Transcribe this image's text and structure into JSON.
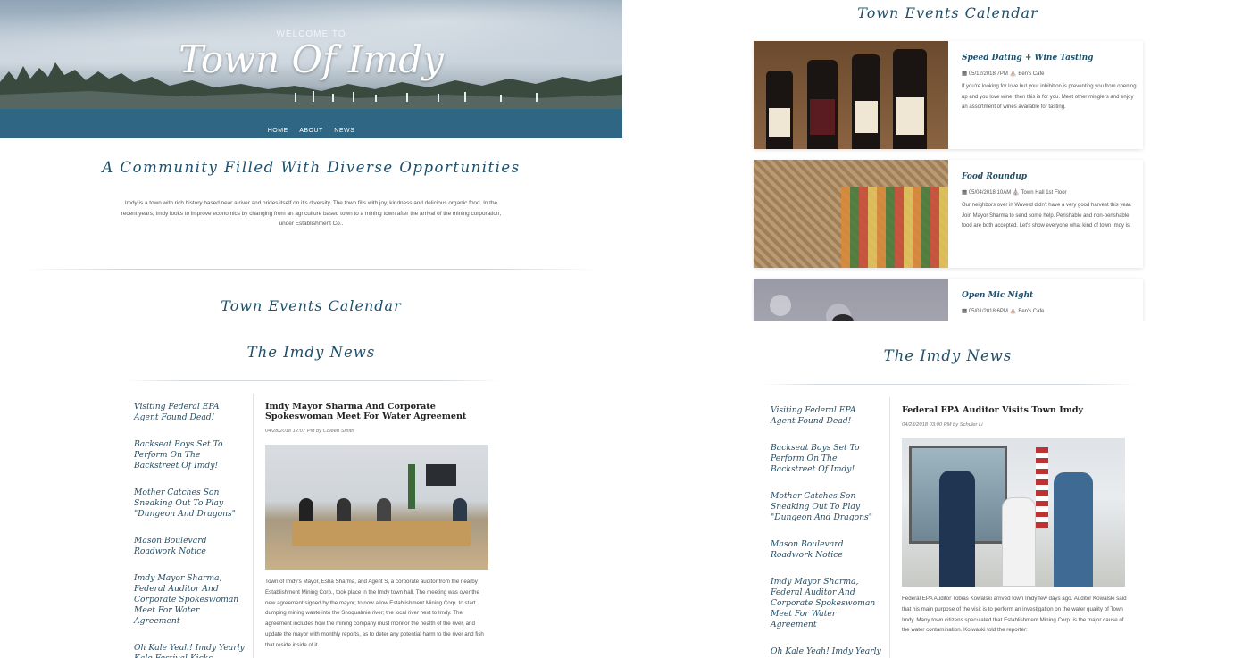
{
  "hero": {
    "welcome": "WELCOME TO",
    "title": "Town Of Imdy",
    "nav": [
      "HOME",
      "ABOUT",
      "NEWS"
    ]
  },
  "intro": {
    "tagline": "A Community Filled With Diverse Opportunities",
    "body": "Imdy is a town with rich history based near a river and prides itself on it's diversity. The town fills with joy, kindness and delicious organic food. In the recent years, Imdy looks to improve economics by changing from an agriculture based town to a mining town after the arrival of the mining corporation, under Establishment Co.."
  },
  "calendar": {
    "heading": "Town Events Calendar",
    "events": [
      {
        "title": "Speed Dating + Wine Tasting",
        "datetime": "05/12/2018 7PM",
        "location": "Ben's Cafe",
        "description": "If you're looking for love but your inhibition is preventing you from opening up and you love wine, then this is for you. Meet other minglers and enjoy an assortment of wines available for tasting."
      },
      {
        "title": "Food Roundup",
        "datetime": "05/04/2018 10AM",
        "location": "Town Hall 1st Floor",
        "description": "Our neighbors over in Waverd didn't have a very good harvest this year. Join Mayor Sharma to send some help. Perishable and non-perishable food are both accepted. Let's show everyone what kind of town Imdy is!"
      },
      {
        "title": "Open Mic Night",
        "datetime": "05/01/2018 6PM",
        "location": "Ben's Cafe",
        "description": ""
      }
    ]
  },
  "news": {
    "heading": "The Imdy News",
    "sidebar_left": [
      "Visiting Federal EPA Agent Found Dead!",
      "Backseat Boys Set To Perform On The Backstreet Of Imdy!",
      "Mother Catches Son Sneaking Out To Play \"Dungeon And Dragons\"",
      "Mason Boulevard Roadwork Notice",
      "Imdy Mayor Sharma, Federal Auditor And Corporate Spokeswoman Meet For Water Agreement",
      "Oh Kale Yeah! Imdy Yearly Kale Festival Kicks"
    ],
    "sidebar_right": [
      "Visiting Federal EPA Agent Found Dead!",
      "Backseat Boys Set To Perform On The Backstreet Of Imdy!",
      "Mother Catches Son Sneaking Out To Play \"Dungeon And Dragons\"",
      "Mason Boulevard Roadwork Notice",
      "Imdy Mayor Sharma, Federal Auditor And Corporate Spokeswoman Meet For Water Agreement",
      "Oh Kale Yeah! Imdy Yearly Kale Festival Kicks"
    ],
    "article_left": {
      "title": "Imdy Mayor Sharma And Corporate Spokeswoman Meet For Water Agreement",
      "meta": "04/28/2018 12:07 PM by Coleen Smith",
      "body": "Town of Imdy's Mayor, Esha Sharma, and Agent S, a corporate auditor from the nearby Establishment Mining Corp., took place in the Imdy town hall. The meeting was over the new agreement signed by the mayor; to now allow Establishment Mining Corp. to start dumping mining waste into the Snoqualmie river; the local river next to Imdy. The agreement includes how the mining company must monitor the health of the river, and update the mayor with monthly reports, as to deter any potential harm to the river and fish that reside inside of it."
    },
    "article_right": {
      "title": "Federal EPA Auditor Visits Town Imdy",
      "meta": "04/23/2018 03:00 PM by Schuler Li",
      "body": "Federal EPA Auditor Tobias Kowalski arrived town Imdy few days ago. Auditor Kowalski said that his main purpose of the visit is to perform an investigation on the water quality of Town Imdy. Many town citizens speculated that Establishment Mining Corp. is the major cause of the water contamination. Kolwaski told the reporter:"
    }
  },
  "colors": {
    "heading_teal": "#1e4f6b",
    "hero_water": "#2f6683"
  }
}
